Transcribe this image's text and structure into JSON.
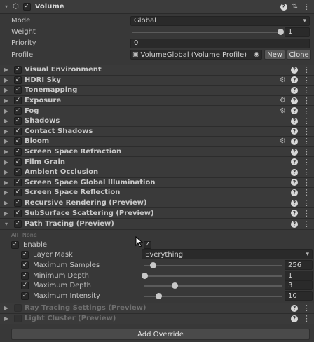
{
  "header": {
    "title": "Volume"
  },
  "props": {
    "mode": {
      "label": "Mode",
      "value": "Global"
    },
    "weight": {
      "label": "Weight",
      "value": "1",
      "level": 1.0
    },
    "priority": {
      "label": "Priority",
      "value": "0"
    },
    "profile": {
      "label": "Profile",
      "value": "VolumeGlobal (Volume Profile)",
      "new": "New",
      "clone": "Clone"
    }
  },
  "overrides": [
    {
      "name": "Visual Environment",
      "gear": false
    },
    {
      "name": "HDRI Sky",
      "gear": true
    },
    {
      "name": "Tonemapping",
      "gear": false
    },
    {
      "name": "Exposure",
      "gear": true
    },
    {
      "name": "Fog",
      "gear": true
    },
    {
      "name": "Shadows",
      "gear": false
    },
    {
      "name": "Contact Shadows",
      "gear": false
    },
    {
      "name": "Bloom",
      "gear": true
    },
    {
      "name": "Screen Space Refraction",
      "gear": false
    },
    {
      "name": "Film Grain",
      "gear": false
    },
    {
      "name": "Ambient Occlusion",
      "gear": false
    },
    {
      "name": "Screen Space Global Illumination",
      "gear": false
    },
    {
      "name": "Screen Space Reflection",
      "gear": false
    },
    {
      "name": "Recursive Rendering (Preview)",
      "gear": false
    },
    {
      "name": "SubSurface Scattering (Preview)",
      "gear": false
    }
  ],
  "path_tracing": {
    "name": "Path Tracing (Preview)",
    "all": "All",
    "none": "None",
    "enable": "Enable",
    "layer_mask": {
      "label": "Layer Mask",
      "value": "Everything"
    },
    "max_samples": {
      "label": "Maximum Samples",
      "value": "256",
      "level": 0.06
    },
    "min_depth": {
      "label": "Minimum Depth",
      "value": "1",
      "level": 0.0
    },
    "max_depth": {
      "label": "Maximum Depth",
      "value": "3",
      "level": 0.22
    },
    "max_intensity": {
      "label": "Maximum Intensity",
      "value": "10",
      "level": 0.1
    }
  },
  "disabled_overrides": [
    {
      "name": "Ray Tracing Settings (Preview)"
    },
    {
      "name": "Light Cluster (Preview)"
    }
  ],
  "footer": {
    "add_override": "Add Override"
  },
  "colors": {
    "highlight": "#d41f27",
    "bg": "#383838"
  }
}
